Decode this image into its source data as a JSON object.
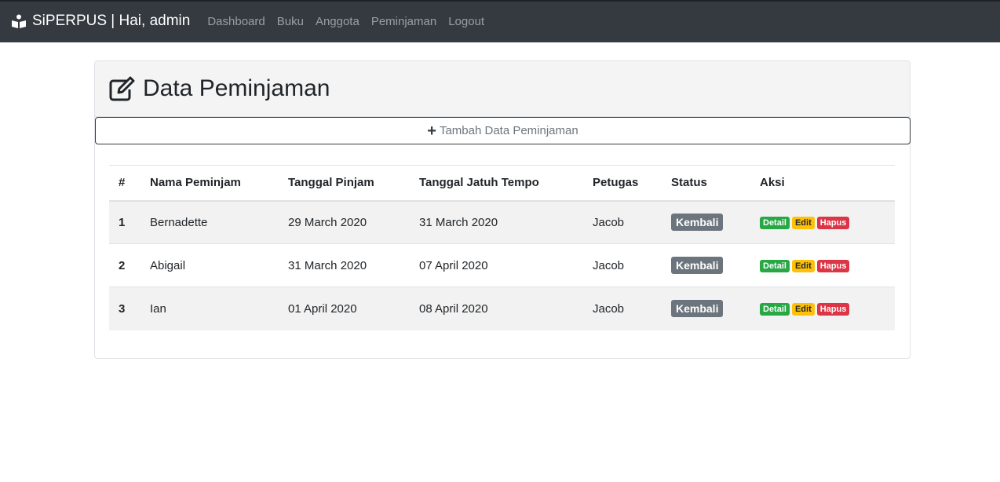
{
  "navbar": {
    "brand": "SiPERPUS | Hai, admin",
    "links": [
      "Dashboard",
      "Buku",
      "Anggota",
      "Peminjaman",
      "Logout"
    ]
  },
  "page": {
    "title": "Data Peminjaman",
    "add_button": "Tambah Data Peminjaman"
  },
  "table": {
    "headers": [
      "#",
      "Nama Peminjam",
      "Tanggal Pinjam",
      "Tanggal Jatuh Tempo",
      "Petugas",
      "Status",
      "Aksi"
    ],
    "rows": [
      {
        "no": "1",
        "nama": "Bernadette",
        "pinjam": "29 March 2020",
        "tempo": "31 March 2020",
        "petugas": "Jacob",
        "status": "Kembali"
      },
      {
        "no": "2",
        "nama": "Abigail",
        "pinjam": "31 March 2020",
        "tempo": "07 April 2020",
        "petugas": "Jacob",
        "status": "Kembali"
      },
      {
        "no": "3",
        "nama": "Ian",
        "pinjam": "01 April 2020",
        "tempo": "08 April 2020",
        "petugas": "Jacob",
        "status": "Kembali"
      }
    ],
    "actions": {
      "detail": "Detail",
      "edit": "Edit",
      "hapus": "Hapus"
    }
  },
  "icons": {
    "brand": "reading-person-icon",
    "title": "edit-icon",
    "add": "plus-icon"
  },
  "colors": {
    "navbar": "#343a40",
    "success": "#28a745",
    "warning": "#ffc107",
    "danger": "#dc3545",
    "secondary": "#6c757d"
  }
}
